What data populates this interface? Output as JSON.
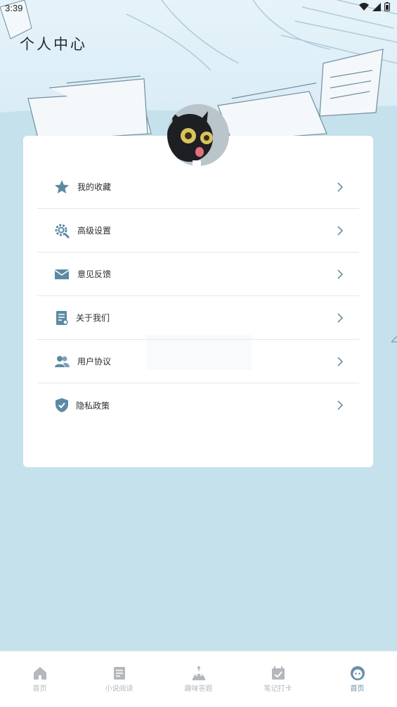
{
  "status_bar": {
    "time": "3:39"
  },
  "header": {
    "title": "个人中心"
  },
  "menu": {
    "items": [
      {
        "label": "我的收藏",
        "icon": "star-icon"
      },
      {
        "label": "高级设置",
        "icon": "gear-search-icon"
      },
      {
        "label": "意见反馈",
        "icon": "mail-icon"
      },
      {
        "label": "关于我们",
        "icon": "document-icon"
      },
      {
        "label": "用户协议",
        "icon": "users-icon"
      },
      {
        "label": "隐私政策",
        "icon": "shield-check-icon"
      }
    ]
  },
  "tabbar": {
    "items": [
      {
        "label": "首页",
        "icon": "home-icon"
      },
      {
        "label": "小说阅读",
        "icon": "book-icon"
      },
      {
        "label": "趣味答题",
        "icon": "robot-icon"
      },
      {
        "label": "笔记打卡",
        "icon": "calendar-check-icon"
      },
      {
        "label": "首页",
        "icon": "profile-face-icon",
        "active": true
      }
    ]
  },
  "colors": {
    "accent": "#6890a8",
    "icon": "#5c8aa3",
    "background": "#c5e1ec",
    "inactive_tab": "#b4b8bc"
  }
}
